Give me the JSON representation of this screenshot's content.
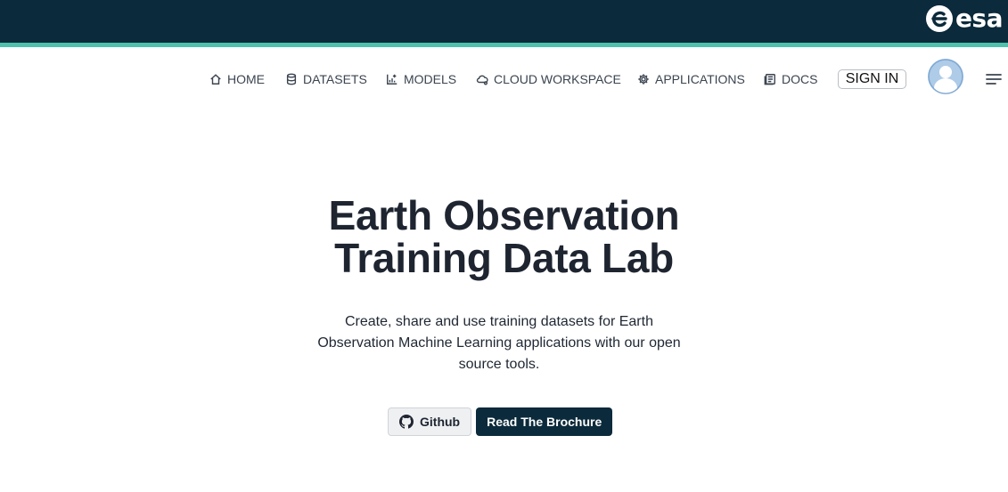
{
  "brand": {
    "logo_text": "esa"
  },
  "nav": {
    "items": [
      {
        "label": "HOME",
        "icon": "home-icon"
      },
      {
        "label": "DATASETS",
        "icon": "database-icon"
      },
      {
        "label": "MODELS",
        "icon": "chart-icon"
      },
      {
        "label": "CLOUD WORKSPACE",
        "icon": "cloud-icon"
      },
      {
        "label": "APPLICATIONS",
        "icon": "gear-icon"
      },
      {
        "label": "DOCS",
        "icon": "docs-icon"
      }
    ],
    "signin_label": "SIGN IN"
  },
  "hero": {
    "title_line1": "Earth Observation",
    "title_line2": "Training Data Lab",
    "description": "Create, share and use training datasets for Earth Observation Machine Learning applications with our open source tools.",
    "github_label": "Github",
    "brochure_label": "Read The Brochure"
  },
  "colors": {
    "header_bg": "#0b2a3b",
    "accent": "#4fc1ad",
    "primary_button": "#0b2a3b"
  }
}
